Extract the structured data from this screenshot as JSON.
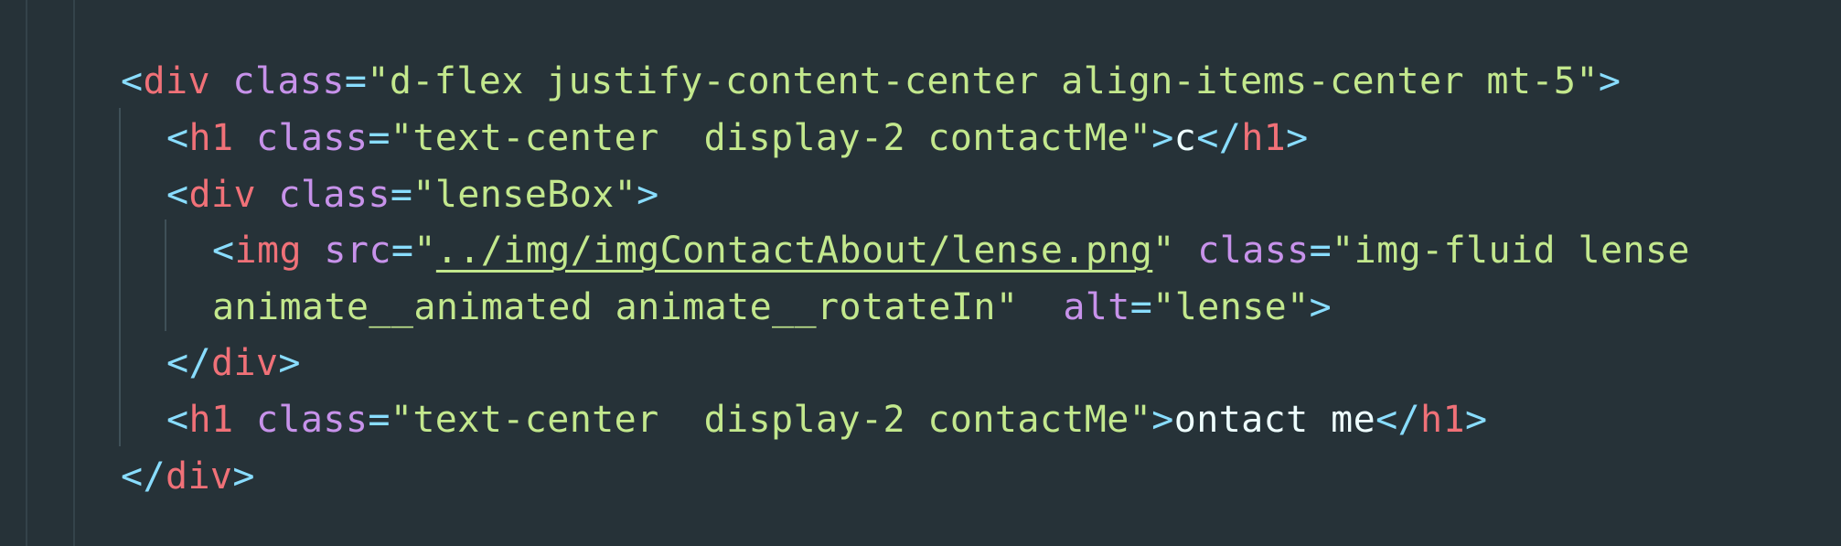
{
  "colors": {
    "background": "#263238",
    "tag": "#f07178",
    "punctuation": "#89ddff",
    "attribute": "#c792ea",
    "string": "#c3e88d",
    "text": "#eeffff"
  },
  "code": {
    "line1": {
      "open": "<",
      "tag": "div",
      "attr": "class",
      "eq": "=",
      "q1": "\"",
      "value": "d-flex justify-content-center align-items-center mt-5",
      "q2": "\"",
      "close": ">"
    },
    "line2": {
      "open": "<",
      "tag": "h1",
      "attr": "class",
      "eq": "=",
      "q1": "\"",
      "value": "text-center  display-2 contactMe",
      "q2": "\"",
      "close": ">",
      "text": "c",
      "end_open": "</",
      "end_tag": "h1",
      "end_close": ">"
    },
    "line3": {
      "open": "<",
      "tag": "div",
      "attr": "class",
      "eq": "=",
      "q1": "\"",
      "value": "lenseBox",
      "q2": "\"",
      "close": ">"
    },
    "line4": {
      "open": "<",
      "tag": "img",
      "attr_src": "src",
      "eq1": "=",
      "q1": "\"",
      "src_value": "../img/imgContactAbout/lense.png",
      "q2": "\"",
      "attr_class": "class",
      "eq2": "=",
      "q3": "\"",
      "class_value": "img-fluid lense"
    },
    "line5": {
      "class_value": "animate__animated animate__rotateIn",
      "q4": "\"",
      "attr_alt": "alt",
      "eq3": "=",
      "q5": "\"",
      "alt_value": "lense",
      "q6": "\"",
      "close": ">"
    },
    "line6": {
      "open": "</",
      "tag": "div",
      "close": ">"
    },
    "line7": {
      "open": "<",
      "tag": "h1",
      "attr": "class",
      "eq": "=",
      "q1": "\"",
      "value": "text-center  display-2 contactMe",
      "q2": "\"",
      "close": ">",
      "text": "ontact me",
      "end_open": "</",
      "end_tag": "h1",
      "end_close": ">"
    },
    "line8": {
      "open": "</",
      "tag": "div",
      "close": ">"
    }
  }
}
